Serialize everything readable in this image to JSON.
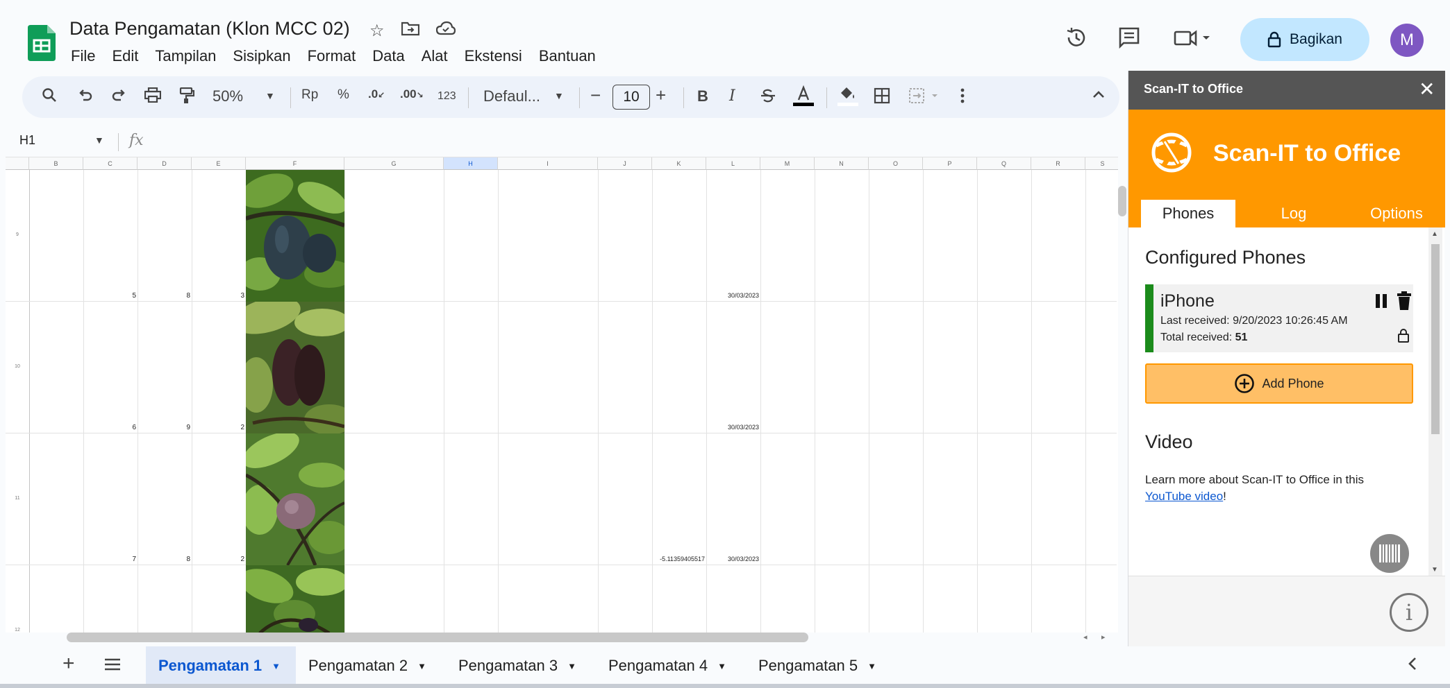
{
  "doc": {
    "title": "Data Pengamatan (Klon MCC 02)",
    "menu": [
      "File",
      "Edit",
      "Tampilan",
      "Sisipkan",
      "Format",
      "Data",
      "Alat",
      "Ekstensi",
      "Bantuan"
    ],
    "share_label": "Bagikan",
    "avatar_letter": "M"
  },
  "toolbar": {
    "zoom": "50%",
    "currency": "Rp",
    "percent": "%",
    "dec_decrease": ".0",
    "dec_increase": ".00",
    "number_format": "123",
    "font": "Defaul...",
    "font_size": "10",
    "bold": "B",
    "italic": "I"
  },
  "formula": {
    "namebox": "H1",
    "fx": "fx"
  },
  "grid": {
    "columns": [
      "B",
      "C",
      "D",
      "E",
      "F",
      "G",
      "H",
      "I",
      "J",
      "K",
      "L",
      "M",
      "N",
      "O",
      "P",
      "Q",
      "R",
      "S"
    ],
    "selected_column": "H",
    "rows": [
      {
        "num": "9",
        "c": "5",
        "d": "8",
        "e": "3",
        "k": "",
        "l": "30/03/2023"
      },
      {
        "num": "10",
        "c": "6",
        "d": "9",
        "e": "2",
        "k": "",
        "l": "30/03/2023"
      },
      {
        "num": "11",
        "c": "7",
        "d": "8",
        "e": "2",
        "k": "-5.11359405517",
        "l": "30/03/2023"
      },
      {
        "num": "12",
        "c": "",
        "d": "",
        "e": "",
        "k": "",
        "l": ""
      }
    ]
  },
  "sheets": {
    "tabs": [
      "Pengamatan 1",
      "Pengamatan 2",
      "Pengamatan 3",
      "Pengamatan 4",
      "Pengamatan 5"
    ],
    "active": "Pengamatan 1"
  },
  "sidebar": {
    "header_title": "Scan-IT to Office",
    "brand": "Scan-IT to Office",
    "tabs": [
      "Phones",
      "Log",
      "Options"
    ],
    "active_tab": "Phones",
    "configured_title": "Configured Phones",
    "phone": {
      "name": "iPhone",
      "last_received_label": "Last received:",
      "last_received": "9/20/2023 10:26:45 AM",
      "total_label": "Total received:",
      "total": "51",
      "status_color": "#1b8b1b"
    },
    "add_phone_label": "Add Phone",
    "video_title": "Video",
    "video_text": "Learn more about Scan-IT to Office in this",
    "video_link": "YouTube video",
    "video_text_end": "!"
  },
  "colors": {
    "accent_orange": "#ff9800",
    "share_bg": "#c2e7ff",
    "sheets_green": "#0f9d58",
    "avatar": "#7e57c2"
  }
}
